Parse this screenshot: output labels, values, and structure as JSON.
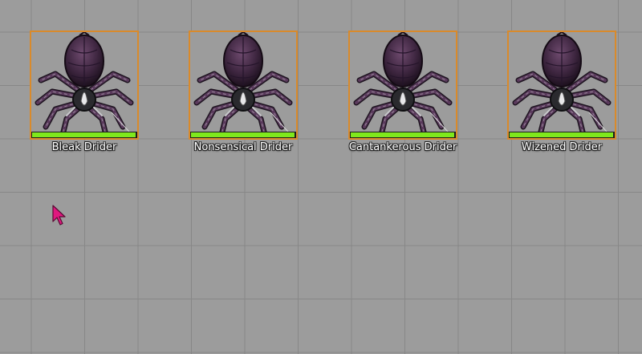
{
  "scene": {
    "grid_color": "#878787",
    "background_color": "#9c9c9c"
  },
  "tokens": [
    {
      "name": "Bleak Drider",
      "hp_fraction": 1.0,
      "icon": "drider-spider-icon"
    },
    {
      "name": "Nonsensical Drider",
      "hp_fraction": 1.0,
      "icon": "drider-spider-icon"
    },
    {
      "name": "Cantankerous Drider",
      "hp_fraction": 1.0,
      "icon": "drider-spider-icon"
    },
    {
      "name": "Wizened Drider",
      "hp_fraction": 1.0,
      "icon": "drider-spider-icon"
    }
  ],
  "colors": {
    "selection_border": "#d98a2b",
    "hp_bar": "#7fe81c",
    "cursor": "#e0177f"
  },
  "cursor": {
    "icon": "mouse-pointer-icon"
  }
}
